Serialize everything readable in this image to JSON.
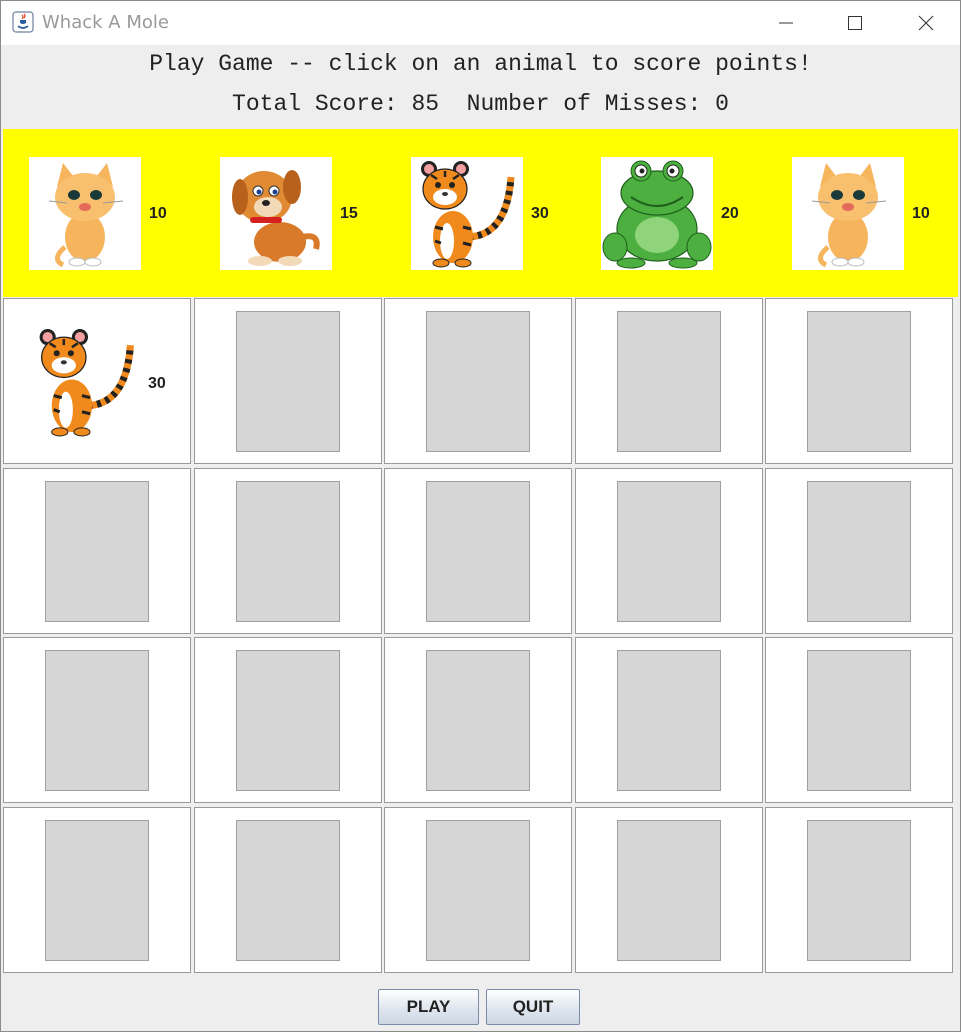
{
  "window": {
    "title": "Whack A Mole",
    "controls": [
      "minimize",
      "maximize",
      "close"
    ]
  },
  "header": {
    "instructions": "Play Game -- click on an animal to score points!",
    "score_line": "Total Score: 85  Number of Misses: 0",
    "total_score": 85,
    "misses": 0
  },
  "animal_bar": {
    "background": "#ffff00",
    "animals": [
      {
        "animal": "cat",
        "points": "10"
      },
      {
        "animal": "dog",
        "points": "15"
      },
      {
        "animal": "tiger",
        "points": "30"
      },
      {
        "animal": "frog",
        "points": "20"
      },
      {
        "animal": "cat",
        "points": "10"
      }
    ]
  },
  "board": {
    "rows": 4,
    "columns": 5,
    "active_cell": {
      "row": 1,
      "column": 1,
      "animal": "tiger",
      "points": "30"
    }
  },
  "buttons": {
    "play": "PLAY",
    "quit": "QUIT"
  }
}
